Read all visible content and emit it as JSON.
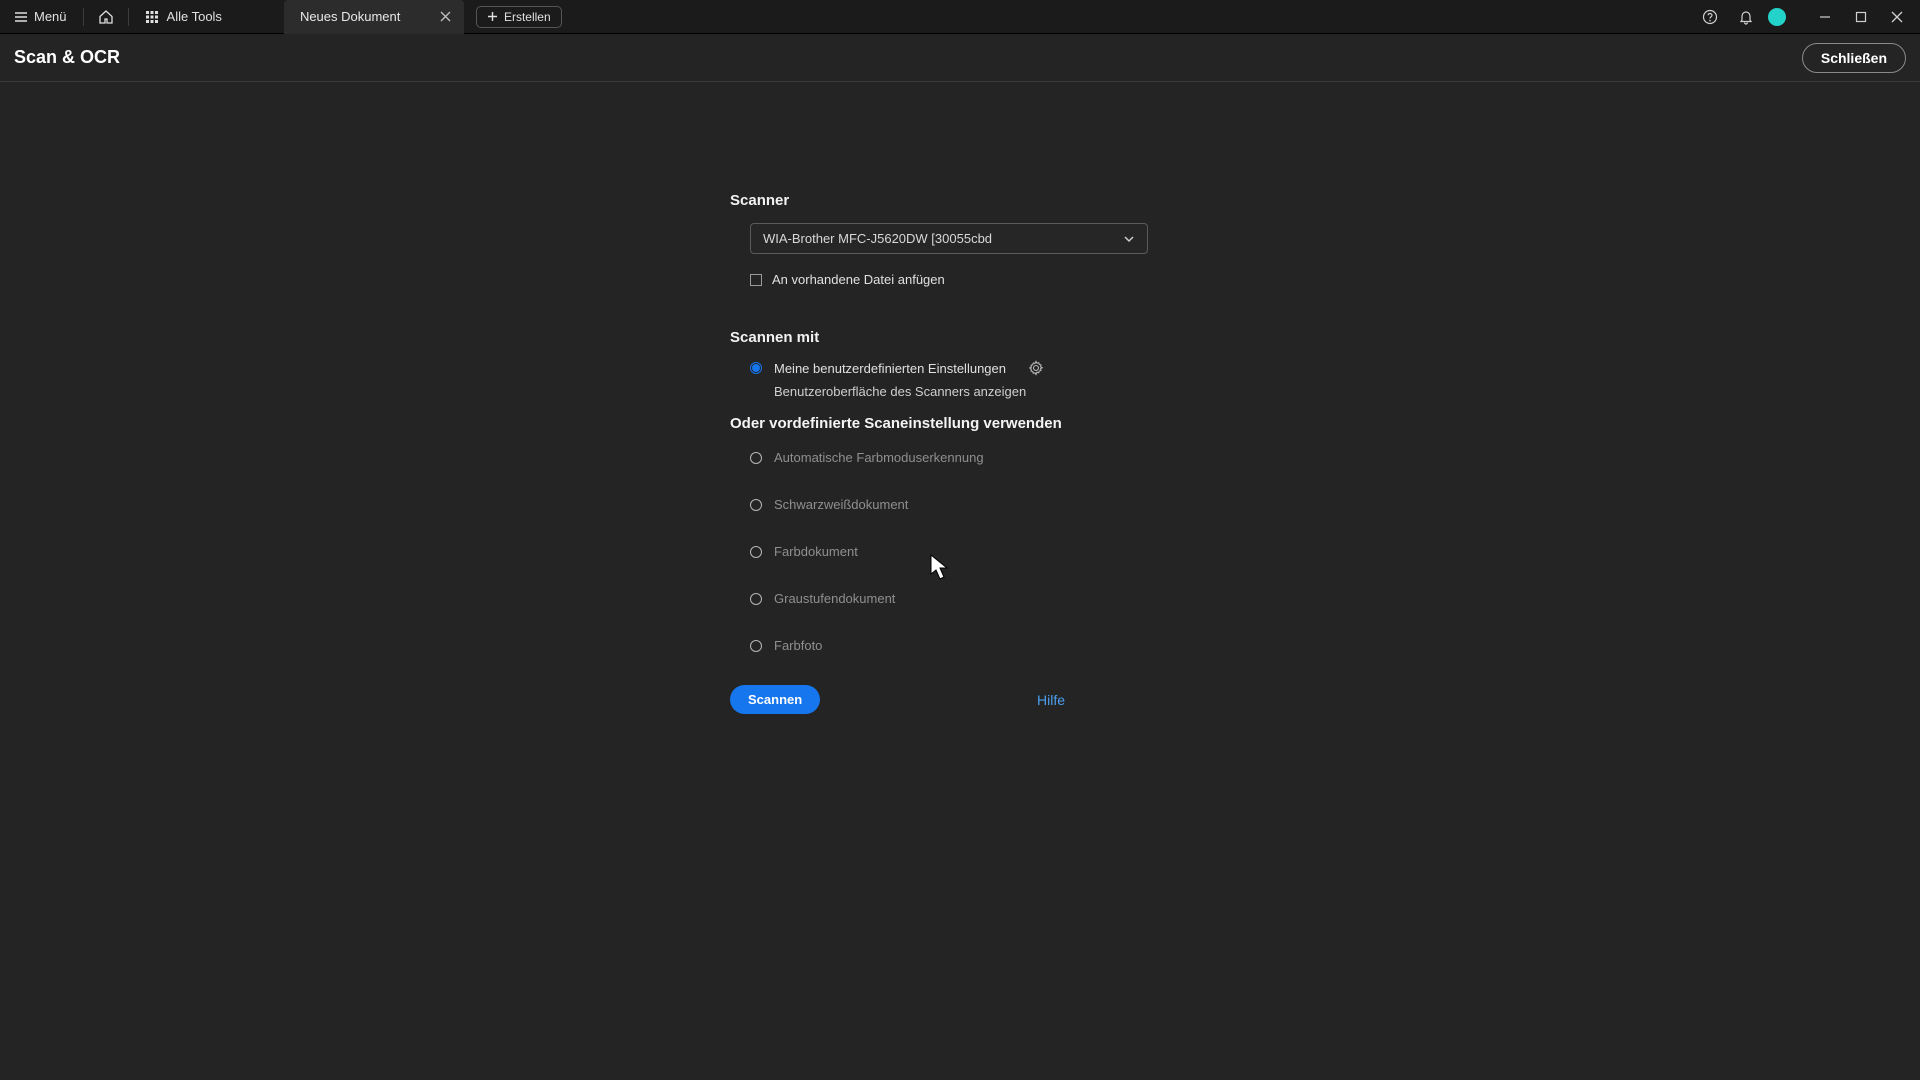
{
  "titlebar": {
    "menu_label": "Menü",
    "all_tools_label": "Alle Tools",
    "tab_title": "Neues Dokument",
    "create_label": "Erstellen"
  },
  "page": {
    "title": "Scan & OCR",
    "close_label": "Schließen"
  },
  "form": {
    "scanner_title": "Scanner",
    "scanner_selected": "WIA-Brother MFC-J5620DW [30055cbd",
    "append_label": "An vorhandene Datei anfügen",
    "scan_with_title": "Scannen mit",
    "custom_label": "Meine benutzerdefinierten Einstellungen",
    "show_scanner_ui": "Benutzeroberfläche des Scanners anzeigen",
    "preset_title": "Oder vordefinierte Scaneinstellung verwenden",
    "presets": [
      "Automatische Farbmoduserkennung",
      "Schwarzweißdokument",
      "Farbdokument",
      "Graustufendokument",
      "Farbfoto"
    ],
    "scan_button": "Scannen",
    "help_label": "Hilfe"
  }
}
